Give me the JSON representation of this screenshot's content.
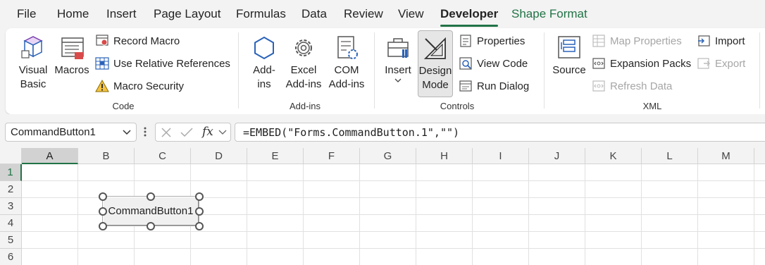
{
  "menu": {
    "tabs": [
      "File",
      "Home",
      "Insert",
      "Page Layout",
      "Formulas",
      "Data",
      "Review",
      "View",
      "Developer",
      "Shape Format"
    ],
    "active": "Developer"
  },
  "ribbon": {
    "code": {
      "label": "Code",
      "visual_basic": "Visual Basic",
      "visual_basic_l1": "Visual",
      "visual_basic_l2": "Basic",
      "macros": "Macros",
      "record_macro": "Record Macro",
      "use_relative": "Use Relative References",
      "macro_security": "Macro Security"
    },
    "addins": {
      "label": "Add-ins",
      "addins_l1": "Add-",
      "addins_l2": "ins",
      "excel_l1": "Excel",
      "excel_l2": "Add-ins",
      "com_l1": "COM",
      "com_l2": "Add-ins"
    },
    "controls": {
      "label": "Controls",
      "insert": "Insert",
      "design_l1": "Design",
      "design_l2": "Mode",
      "properties": "Properties",
      "view_code": "View Code",
      "run_dialog": "Run Dialog"
    },
    "xml": {
      "label": "XML",
      "source": "Source",
      "map_properties": "Map Properties",
      "expansion_packs": "Expansion Packs",
      "refresh_data": "Refresh Data",
      "import": "Import",
      "export": "Export"
    }
  },
  "formula_bar": {
    "name_box": "CommandButton1",
    "fx": "fx",
    "formula": "=EMBED(\"Forms.CommandButton.1\",\"\")"
  },
  "sheet": {
    "columns": [
      "A",
      "B",
      "C",
      "D",
      "E",
      "F",
      "G",
      "H",
      "I",
      "J",
      "K",
      "L",
      "M"
    ],
    "rows": [
      "1",
      "2",
      "3",
      "4",
      "5",
      "6"
    ],
    "selected_column": "A",
    "selected_row": "1"
  },
  "command_button": {
    "label": "CommandButton1"
  },
  "colors": {
    "accent": "#217346"
  }
}
